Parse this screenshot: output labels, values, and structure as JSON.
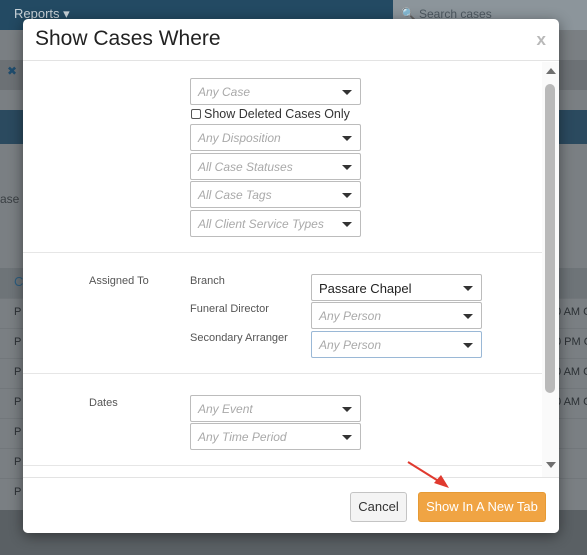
{
  "background": {
    "top_nav_label": "Reports",
    "search_placeholder": "Search cases",
    "case_label_fragment": "ase N",
    "column_header_fragment": "C",
    "row_prefix": "P",
    "row_times": [
      "0 AM C",
      "0 PM O",
      "0 AM C",
      "0 AM C"
    ]
  },
  "modal": {
    "title": "Show Cases Where",
    "close_glyph": "x",
    "case_section": {
      "case_select_placeholder": "Any Case",
      "deleted_only_label": "Show Deleted Cases Only",
      "disposition_placeholder": "Any Disposition",
      "statuses_placeholder": "All Case Statuses",
      "tags_placeholder": "All Case Tags",
      "client_service_types_placeholder": "All Client Service Types"
    },
    "assigned_section": {
      "section_label": "Assigned To",
      "branch_label": "Branch",
      "branch_value": "Passare Chapel",
      "funeral_director_label": "Funeral Director",
      "funeral_director_placeholder": "Any Person",
      "secondary_arranger_label": "Secondary Arranger",
      "secondary_arranger_placeholder": "Any Person"
    },
    "dates_section": {
      "section_label": "Dates",
      "event_placeholder": "Any Event",
      "time_period_placeholder": "Any Time Period"
    },
    "footer": {
      "cancel_label": "Cancel",
      "submit_label": "Show In A New Tab"
    }
  },
  "colors": {
    "primary_button": "#f0a443",
    "annotation_arrow": "#e03a2f",
    "nav_bar": "#234a63"
  }
}
